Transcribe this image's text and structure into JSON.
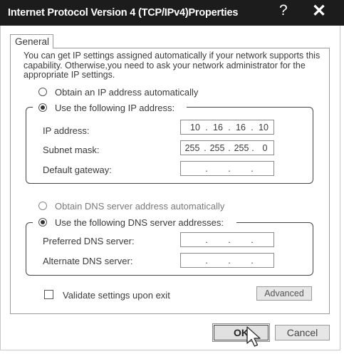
{
  "window": {
    "title": "Internet Protocol Version 4 (TCP/IPv4)Properties",
    "help_glyph": "?",
    "close_glyph": "✕"
  },
  "tabs": [
    {
      "label": "General"
    }
  ],
  "description": "You can get IP settings assigned automatically if your network supports this capability. Otherwise,you need to ask your network administrator for the appropriate IP settings.",
  "ip_section": {
    "auto_label": "Obtain an IP address automatically",
    "auto_selected": false,
    "manual_label": "Use the following IP address:",
    "manual_selected": true,
    "fields": {
      "ip_label": "IP address:",
      "ip_octets": [
        "10",
        "16",
        "16",
        "10"
      ],
      "subnet_label": "Subnet mask:",
      "subnet_octets": [
        "255",
        "255",
        "255",
        "0"
      ],
      "gateway_label": "Default gateway:",
      "gateway_octets": [
        "",
        "",
        "",
        ""
      ]
    }
  },
  "dns_section": {
    "auto_label": "Obtain DNS  server address automatically",
    "auto_selected": false,
    "manual_label": "Use the following DNS server addresses:",
    "manual_selected": true,
    "fields": {
      "preferred_label": "Preferred DNS server:",
      "preferred_octets": [
        "",
        "",
        "",
        ""
      ],
      "alternate_label": "Alternate DNS server:",
      "alternate_octets": [
        "",
        "",
        "",
        ""
      ]
    }
  },
  "validate": {
    "label": "Validate settings upon exit",
    "checked": false
  },
  "buttons": {
    "advanced": "Advanced",
    "ok": "OK",
    "cancel": "Cancel"
  },
  "field_separator": ".",
  "colors": {
    "titlebar": "#1c1c1c",
    "title_text": "#ffffff"
  }
}
